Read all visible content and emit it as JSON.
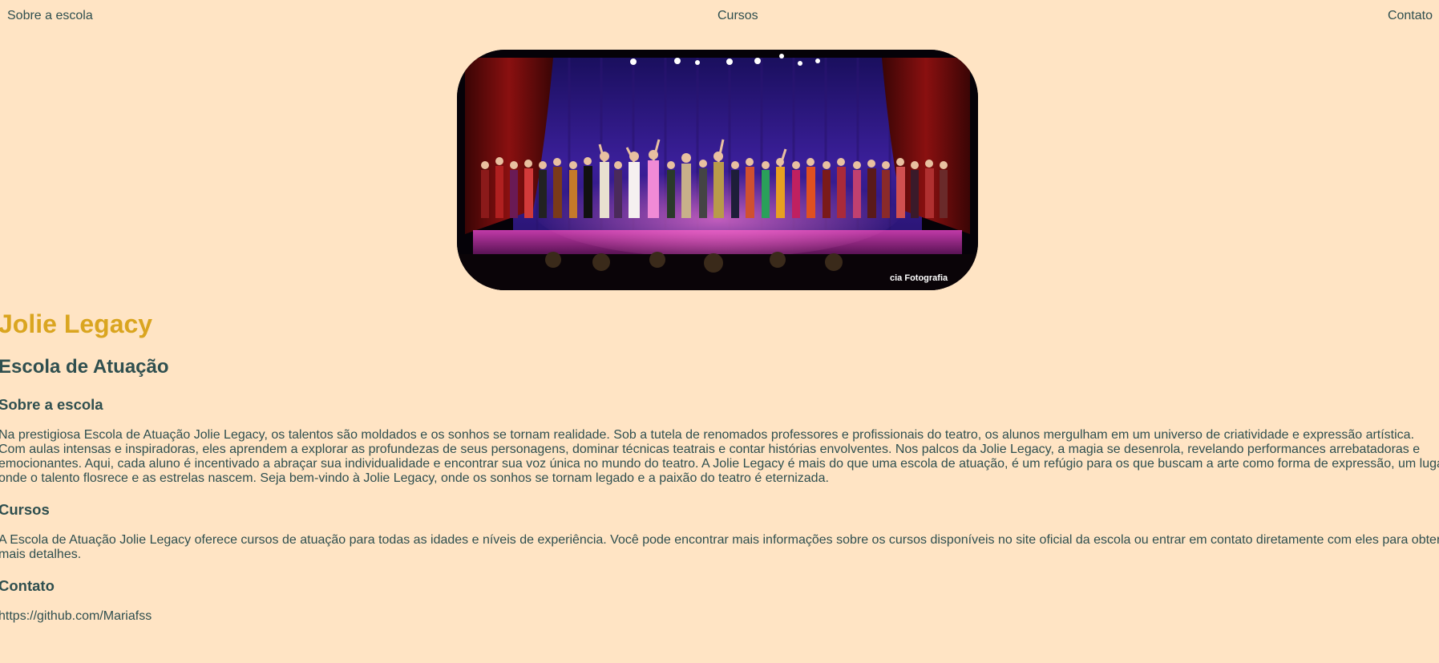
{
  "nav": {
    "items": [
      {
        "label": "Sobre a escola"
      },
      {
        "label": "Cursos"
      },
      {
        "label": "Contato"
      }
    ]
  },
  "hero": {
    "alt": "Apresentação de teatro musical no palco",
    "watermark": "cia Fotografia"
  },
  "header": {
    "title": "Jolie Legacy",
    "subtitle": "Escola de Atuação"
  },
  "sections": {
    "sobre": {
      "heading": "Sobre a escola",
      "lines": [
        "Na prestigiosa Escola de Atuação Jolie Legacy, os talentos são moldados e os sonhos se tornam realidade. Sob a tutela de renomados professores e profissionais do teatro, os alunos mergulham em um universo de criatividade e expressão artística.",
        "Com aulas intensas e inspiradoras, eles aprendem a explorar as profundezas de seus personagens, dominar técnicas teatrais e contar histórias envolventes. Nos palcos da Jolie Legacy, a magia se desenrola, revelando performances arrebatadoras e",
        "emocionantes. Aqui, cada aluno é incentivado a abraçar sua individualidade e encontrar sua voz única no mundo do teatro. A Jolie Legacy é mais do que uma escola de atuação, é um refúgio para os que buscam a arte como forma de expressão, um lugar",
        "onde o talento flosrece e as estrelas nascem. Seja bem-vindo à Jolie Legacy, onde os sonhos se tornam legado e a paixão do teatro é eternizada."
      ]
    },
    "cursos": {
      "heading": "Cursos",
      "lines": [
        "A Escola de Atuação Jolie Legacy oferece cursos de atuação para todas as idades e níveis de experiência. Você pode encontrar mais informações sobre os cursos disponíveis no site oficial da escola ou entrar em contato diretamente com eles para obter",
        "mais detalhes."
      ]
    },
    "contato": {
      "heading": "Contato",
      "text": "https://github.com/Mariafss"
    }
  },
  "colors": {
    "background": "#ffe4c4",
    "title": "#daa520",
    "text": "#2f4f4f"
  }
}
